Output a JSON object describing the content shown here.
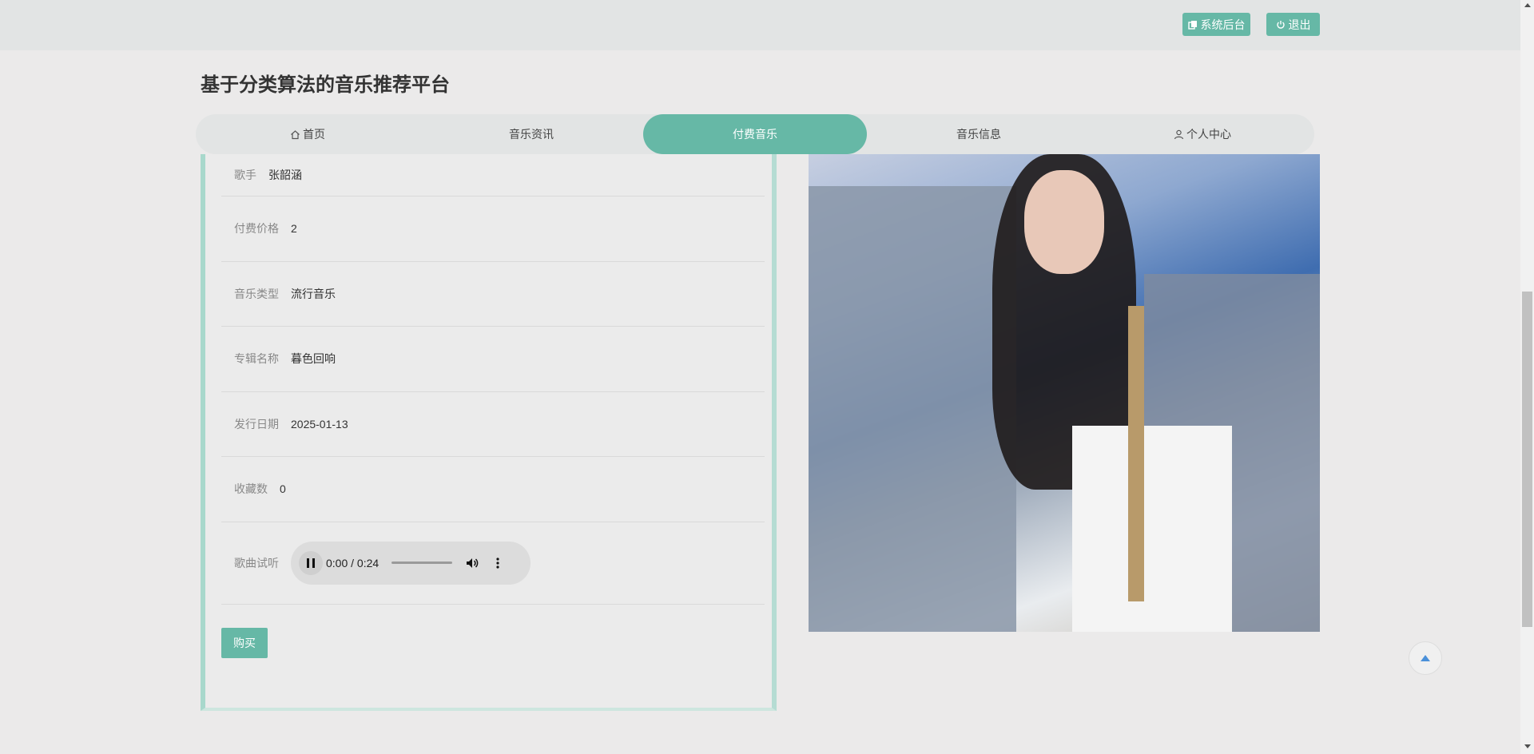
{
  "header": {
    "admin_label": "系统后台",
    "logout_label": "退出"
  },
  "site": {
    "title": "基于分类算法的音乐推荐平台"
  },
  "nav": {
    "items": [
      {
        "label": "首页",
        "icon": "home-icon"
      },
      {
        "label": "音乐资讯"
      },
      {
        "label": "付费音乐",
        "active": true
      },
      {
        "label": "音乐信息"
      },
      {
        "label": "个人中心",
        "icon": "user-icon"
      }
    ]
  },
  "detail": {
    "fields": [
      {
        "label": "歌手",
        "value": "张韶涵"
      },
      {
        "label": "付费价格",
        "value": "2"
      },
      {
        "label": "音乐类型",
        "value": "流行音乐"
      },
      {
        "label": "专辑名称",
        "value": "暮色回响"
      },
      {
        "label": "发行日期",
        "value": "2025-01-13"
      },
      {
        "label": "收藏数",
        "value": "0"
      }
    ],
    "preview_label": "歌曲试听",
    "audio_time": "0:00 / 0:24",
    "audio_progress": 0,
    "buy_label": "购买"
  },
  "colors": {
    "accent": "#66b8a6",
    "panel_border": "#a8d8cc"
  }
}
